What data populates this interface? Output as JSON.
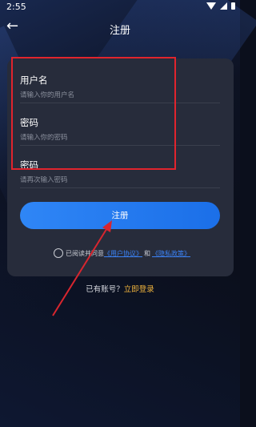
{
  "status_bar": {
    "time": "2:55"
  },
  "header": {
    "title": "注册",
    "back_icon": "←"
  },
  "form": {
    "username": {
      "label": "用户名",
      "placeholder": "请输入你的用户名"
    },
    "password": {
      "label": "密码",
      "placeholder": "请输入你的密码"
    },
    "confirm": {
      "label": "密码",
      "placeholder": "请再次输入密码"
    }
  },
  "register_button": {
    "label": "注册"
  },
  "agreement": {
    "prefix": "已阅读并同意",
    "user_agreement": "《用户协议》",
    "and": "和",
    "privacy": "《隐私政策》"
  },
  "login_row": {
    "question": "已有账号？",
    "login_link": "立即登录"
  },
  "colors": {
    "highlight": "#e0242d",
    "accent": "#2f86f6",
    "login_link": "#f2b53d"
  }
}
